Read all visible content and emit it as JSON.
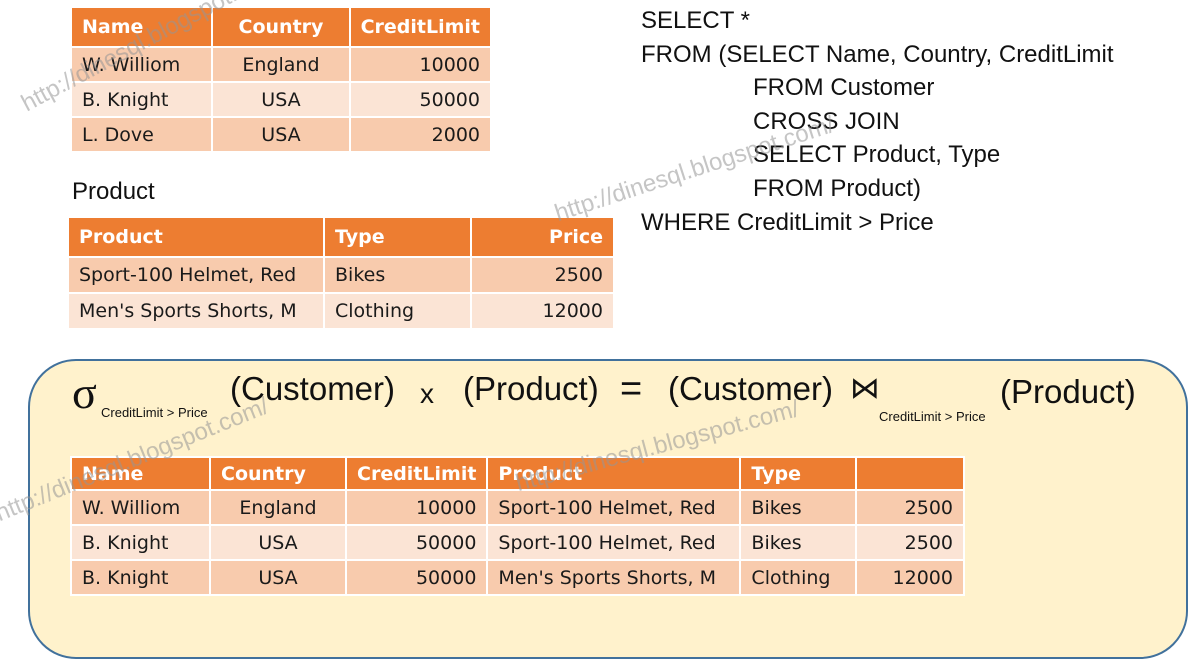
{
  "customer_table": {
    "headers": [
      "Name",
      "Country",
      "CreditLimit"
    ],
    "rows": [
      [
        "W. Williom",
        "England",
        "10000"
      ],
      [
        "B. Knight",
        "USA",
        "50000"
      ],
      [
        "L. Dove",
        "USA",
        "2000"
      ]
    ]
  },
  "product_caption": "Product",
  "product_table": {
    "headers": [
      "Product",
      "Type",
      "Price"
    ],
    "rows": [
      [
        "Sport-100 Helmet, Red",
        "Bikes",
        "2500"
      ],
      [
        "Men's Sports Shorts, M",
        "Clothing",
        "12000"
      ]
    ]
  },
  "sql": {
    "lines": [
      "SELECT *",
      "FROM (SELECT Name, Country, CreditLimit",
      "FROM Customer",
      "CROSS JOIN",
      "SELECT Product, Type",
      "FROM Product)",
      "WHERE CreditLimit > Price"
    ]
  },
  "algebra": {
    "sigma": "σ",
    "select_condition": "CreditLimit > Price",
    "left_relation": "(Customer)",
    "cross_symbol": "x",
    "right_relation": "(Product)",
    "equals_symbol": "=",
    "join_left": "(Customer)",
    "join_symbol": "⋈",
    "join_condition": "CreditLimit > Price",
    "join_right": "(Product)"
  },
  "result_table": {
    "headers": [
      "Name",
      "Country",
      "CreditLimit",
      "Product",
      "Type",
      ""
    ],
    "rows": [
      [
        "W. Williom",
        "England",
        "10000",
        "Sport-100 Helmet, Red",
        "Bikes",
        "2500"
      ],
      [
        "B. Knight",
        "USA",
        "50000",
        "Sport-100 Helmet, Red",
        "Bikes",
        "2500"
      ],
      [
        "B. Knight",
        "USA",
        "50000",
        "Men's Sports Shorts, M",
        "Clothing",
        "12000"
      ]
    ]
  },
  "watermark": "http://dinesql.blogspot.com/",
  "colors": {
    "header": "#ed7d31",
    "row_odd": "#f8cbad",
    "row_even": "#fbe4d5",
    "panel_fill": "#fff2cc",
    "panel_border": "#41719c"
  }
}
